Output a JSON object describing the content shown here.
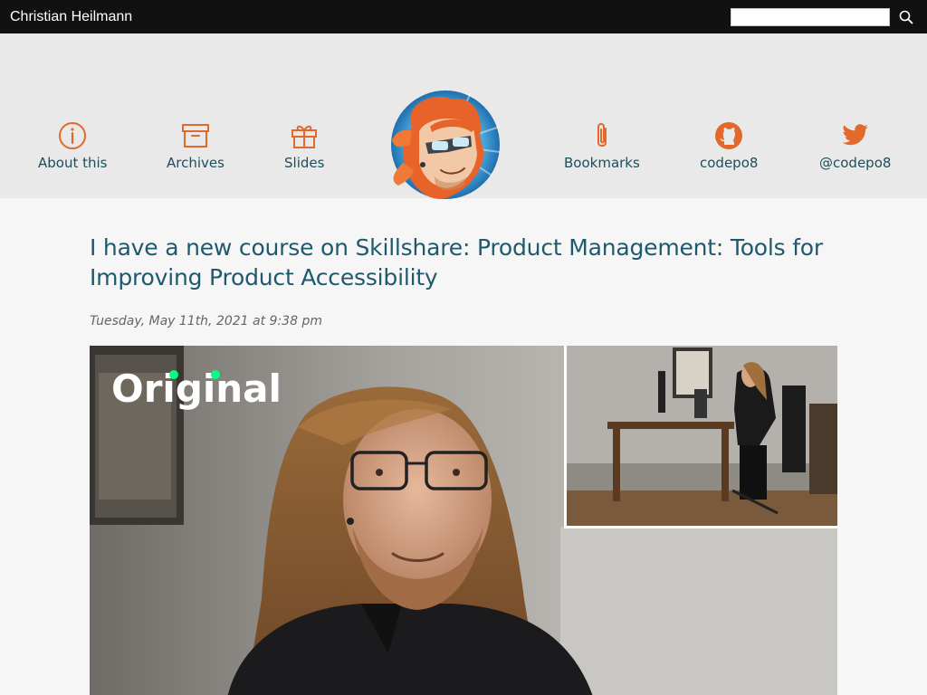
{
  "topbar": {
    "site_name": "Christian Heilmann",
    "search_value": ""
  },
  "nav": {
    "left": [
      {
        "label": "About this",
        "icon": "info-circle-icon"
      },
      {
        "label": "Archives",
        "icon": "archive-box-icon"
      },
      {
        "label": "Slides",
        "icon": "gift-icon"
      }
    ],
    "right": [
      {
        "label": "Bookmarks",
        "icon": "paperclip-icon"
      },
      {
        "label": "codepo8",
        "icon": "github-icon"
      },
      {
        "label": "@codepo8",
        "icon": "twitter-icon"
      }
    ]
  },
  "post": {
    "title": "I have a new course on Skillshare: Product Management: Tools for Improving Product Accessibility",
    "date": "Tuesday, May 11th, 2021 at 9:38 pm"
  },
  "hero": {
    "badge_text": "Original"
  },
  "colors": {
    "accent": "#e2692c",
    "link": "#1e5a6d",
    "topbar": "#111111",
    "header_bg": "#e9e9e9"
  }
}
